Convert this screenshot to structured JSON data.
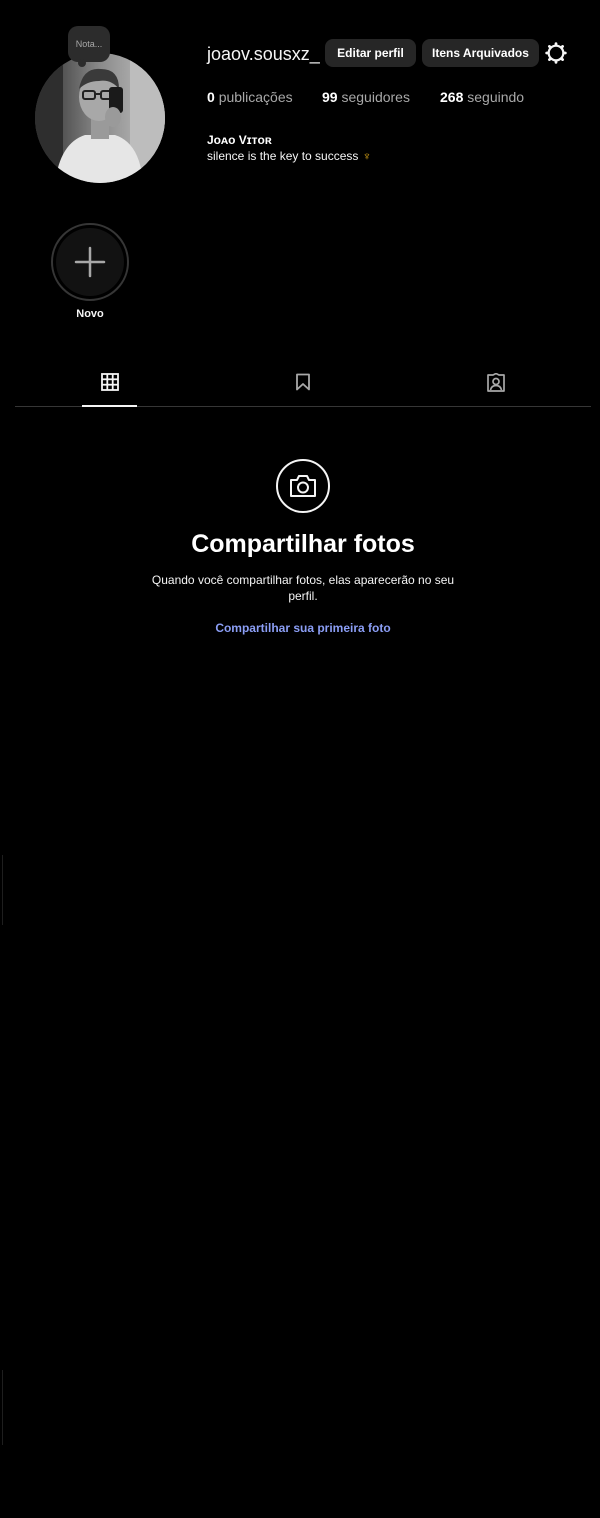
{
  "profile": {
    "note": "Nota...",
    "username": "joaov.sousxz_",
    "edit_button": "Editar perfil",
    "archive_button": "Itens Arquivados",
    "stats": {
      "posts_count": "0",
      "posts_label": "publicações",
      "followers_count": "99",
      "followers_label": "seguidores",
      "following_count": "268",
      "following_label": "seguindo"
    },
    "full_name": "Jᴏᴀᴏ Vɪᴛᴏʀ",
    "bio": "silence is the key to success",
    "bio_emoji": "♆"
  },
  "highlights": {
    "new_label": "Novo"
  },
  "tabs": {
    "icons": [
      "grid-icon",
      "bookmark-icon",
      "tagged-user-icon"
    ],
    "active": "posts"
  },
  "empty_state": {
    "title": "Compartilhar fotos",
    "description": "Quando você compartilhar fotos, elas aparecerão no seu perfil.",
    "link": "Compartilhar sua primeira foto"
  },
  "colors": {
    "background": "#000000",
    "button_bg": "#262626",
    "link": "#8b9ef5",
    "divider": "#363636"
  }
}
